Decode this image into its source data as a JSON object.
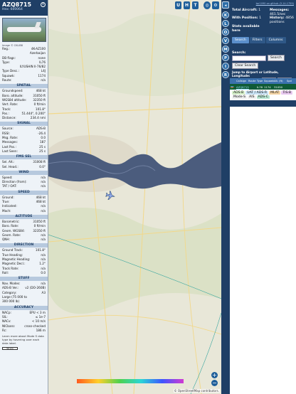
{
  "left": {
    "callsign": "AZQ8715",
    "hex": "Hex: 600064",
    "image_caption": "Image © CKLIB8",
    "info": [
      {
        "k": "Reg.:",
        "v": "4K-AZ100"
      },
      {
        "k": "",
        "v": "Azerbaijan"
      },
      {
        "k": "DB flags:",
        "v": "none"
      },
      {
        "k": "Type:",
        "v": "IL76"
      },
      {
        "k": "",
        "v": "ILYUSHIN Il-76/82"
      },
      {
        "k": "Type Desc.:",
        "v": "L4J"
      },
      {
        "k": "Squawk:",
        "v": "1174"
      },
      {
        "k": "Route:",
        "v": "n/a"
      }
    ],
    "spatial_title": "SPATIAL",
    "spatial": [
      {
        "k": "Groundspeed:",
        "v": "468 kt"
      },
      {
        "k": "Baro. altitude:",
        "v": "31050 ft"
      },
      {
        "k": "WGS84 altitude:",
        "v": "32350 ft"
      },
      {
        "k": "Vert. Rate:",
        "v": "0 ft/min"
      },
      {
        "k": "Track:",
        "v": "101.8°"
      },
      {
        "k": "Pos.:",
        "v": "51.444°, 0.200°"
      },
      {
        "k": "Distance:",
        "v": "234.4 nmi"
      }
    ],
    "signal_title": "SIGNAL",
    "signal": [
      {
        "k": "Source:",
        "v": "ADS-B"
      },
      {
        "k": "RSSI:",
        "v": "-26.4"
      },
      {
        "k": "Msg. Rate:",
        "v": "0.0"
      },
      {
        "k": "Messages:",
        "v": "187"
      },
      {
        "k": "Last Pos.:",
        "v": "25 s"
      },
      {
        "k": "Last Seen:",
        "v": "25 s"
      }
    ],
    "fms_title": "FMS SEL",
    "fms": [
      {
        "k": "Sel. Alt.:",
        "v": "31008 ft"
      },
      {
        "k": "Sel. Head.:",
        "v": "0.0°"
      }
    ],
    "wind_title": "WIND",
    "wind": [
      {
        "k": "Speed:",
        "v": "n/a"
      },
      {
        "k": "Direction (from):",
        "v": "n/a"
      },
      {
        "k": "TAT / OAT:",
        "v": "n/a"
      }
    ],
    "speed_title": "SPEED",
    "speed": [
      {
        "k": "Ground:",
        "v": "468 kt"
      },
      {
        "k": "True:",
        "v": "468 kt"
      },
      {
        "k": "Indicated:",
        "v": "n/a"
      },
      {
        "k": "Mach:",
        "v": "n/a"
      }
    ],
    "altitude_title": "ALTITUDE",
    "altitude": [
      {
        "k": "Barometric:",
        "v": "31050 ft"
      },
      {
        "k": "Baro. Rate:",
        "v": "0 ft/min"
      },
      {
        "k": "Geom. WGS84:",
        "v": "32350 ft"
      },
      {
        "k": "Geom. Rate:",
        "v": "n/a"
      },
      {
        "k": "QNH:",
        "v": "n/a"
      }
    ],
    "direction_title": "DIRECTION",
    "direction": [
      {
        "k": "Ground Track:",
        "v": "101.8°"
      },
      {
        "k": "True Heading:",
        "v": "n/a"
      },
      {
        "k": "Magnetic Heading:",
        "v": "n/a"
      },
      {
        "k": "Magnetic Decl.:",
        "v": "1.2°"
      },
      {
        "k": "Track Rate:",
        "v": "n/a"
      },
      {
        "k": "Roll:",
        "v": "0.0"
      }
    ],
    "stuff_title": "STUFF",
    "stuff": [
      {
        "k": "Nav. Modes:",
        "v": "n/a"
      },
      {
        "k": "ADS-B Ver.:",
        "v": "v2 (DO-260B)"
      },
      {
        "k": "Category:",
        "v": "A3"
      },
      {
        "k": "Large (75 000 to",
        "v": ""
      },
      {
        "k": "300 000 lb)",
        "v": ""
      }
    ],
    "accuracy_title": "ACCURACY",
    "accuracy": [
      {
        "k": "NACp:",
        "v": "EPU < 3 m"
      },
      {
        "k": "SIL:",
        "v": "≤ 1e-7"
      },
      {
        "k": "NACv:",
        "v": "< 10 m/s"
      },
      {
        "k": "NICbaro:",
        "v": "cross-checked"
      },
      {
        "k": "Rc:",
        "v": "186 m"
      }
    ],
    "footer": "Learn more about Mode S data type by hovering over each data label.",
    "scale": "50 km"
  },
  "map": {
    "top_buttons": [
      "U",
      "H",
      "T"
    ],
    "attribution": "© OpenStreetMap contributors.",
    "zoom_in": "+",
    "zoom_out": "−",
    "colors": {
      "land": "#e8e7d8",
      "water": "#4b5c7d",
      "green": "#cfdcb8",
      "road": "#f2d88a"
    }
  },
  "sidebar": {
    "buttons": [
      "K",
      "L",
      "O",
      "V",
      "M",
      "P",
      "I",
      "R"
    ],
    "github": "tar1090 on github (3.14.1759)",
    "total_aircraft_label": "Total Aircraft:",
    "total_aircraft": "1",
    "messages_label": "Messages:",
    "messages": "461.5/sec",
    "with_position_label": "With Position:",
    "with_position": "1",
    "history_label": "History:",
    "history": "4856 positions",
    "stats_available": "Stats available here",
    "tabs": [
      "Search",
      "Filters",
      "Columns"
    ],
    "search_label": "Search:",
    "search_button": "Search",
    "clear_search": "Clear Search",
    "jump_label": "Jump to Airport or Latitude, Longitude:",
    "jump_button": "Jump",
    "clear_button": "Clear",
    "table_headers": [
      "",
      "Callsign",
      "Route",
      "Type",
      "Squawk",
      "Alt. (ft)",
      "Spd"
    ],
    "table_rows": [
      {
        "flag": "🇦🇿",
        "callsign": "AZQ8715",
        "route": "",
        "type": "IL76",
        "squawk": "1174",
        "alt": "31050",
        "spd": ""
      }
    ],
    "chips_row1": [
      "ADS-B",
      "UAT / ADS-R",
      "MLAT",
      "TIS-B"
    ],
    "chips_row2": [
      "Mode-S",
      "AIS",
      "ADS-C"
    ],
    "chip_colors": [
      "#d6f0c9",
      "#c9e3f5",
      "#f4d4a5",
      "#e8c9f0",
      "#f0f0f0",
      "#f0f0f0",
      "#b8e6d2"
    ]
  }
}
